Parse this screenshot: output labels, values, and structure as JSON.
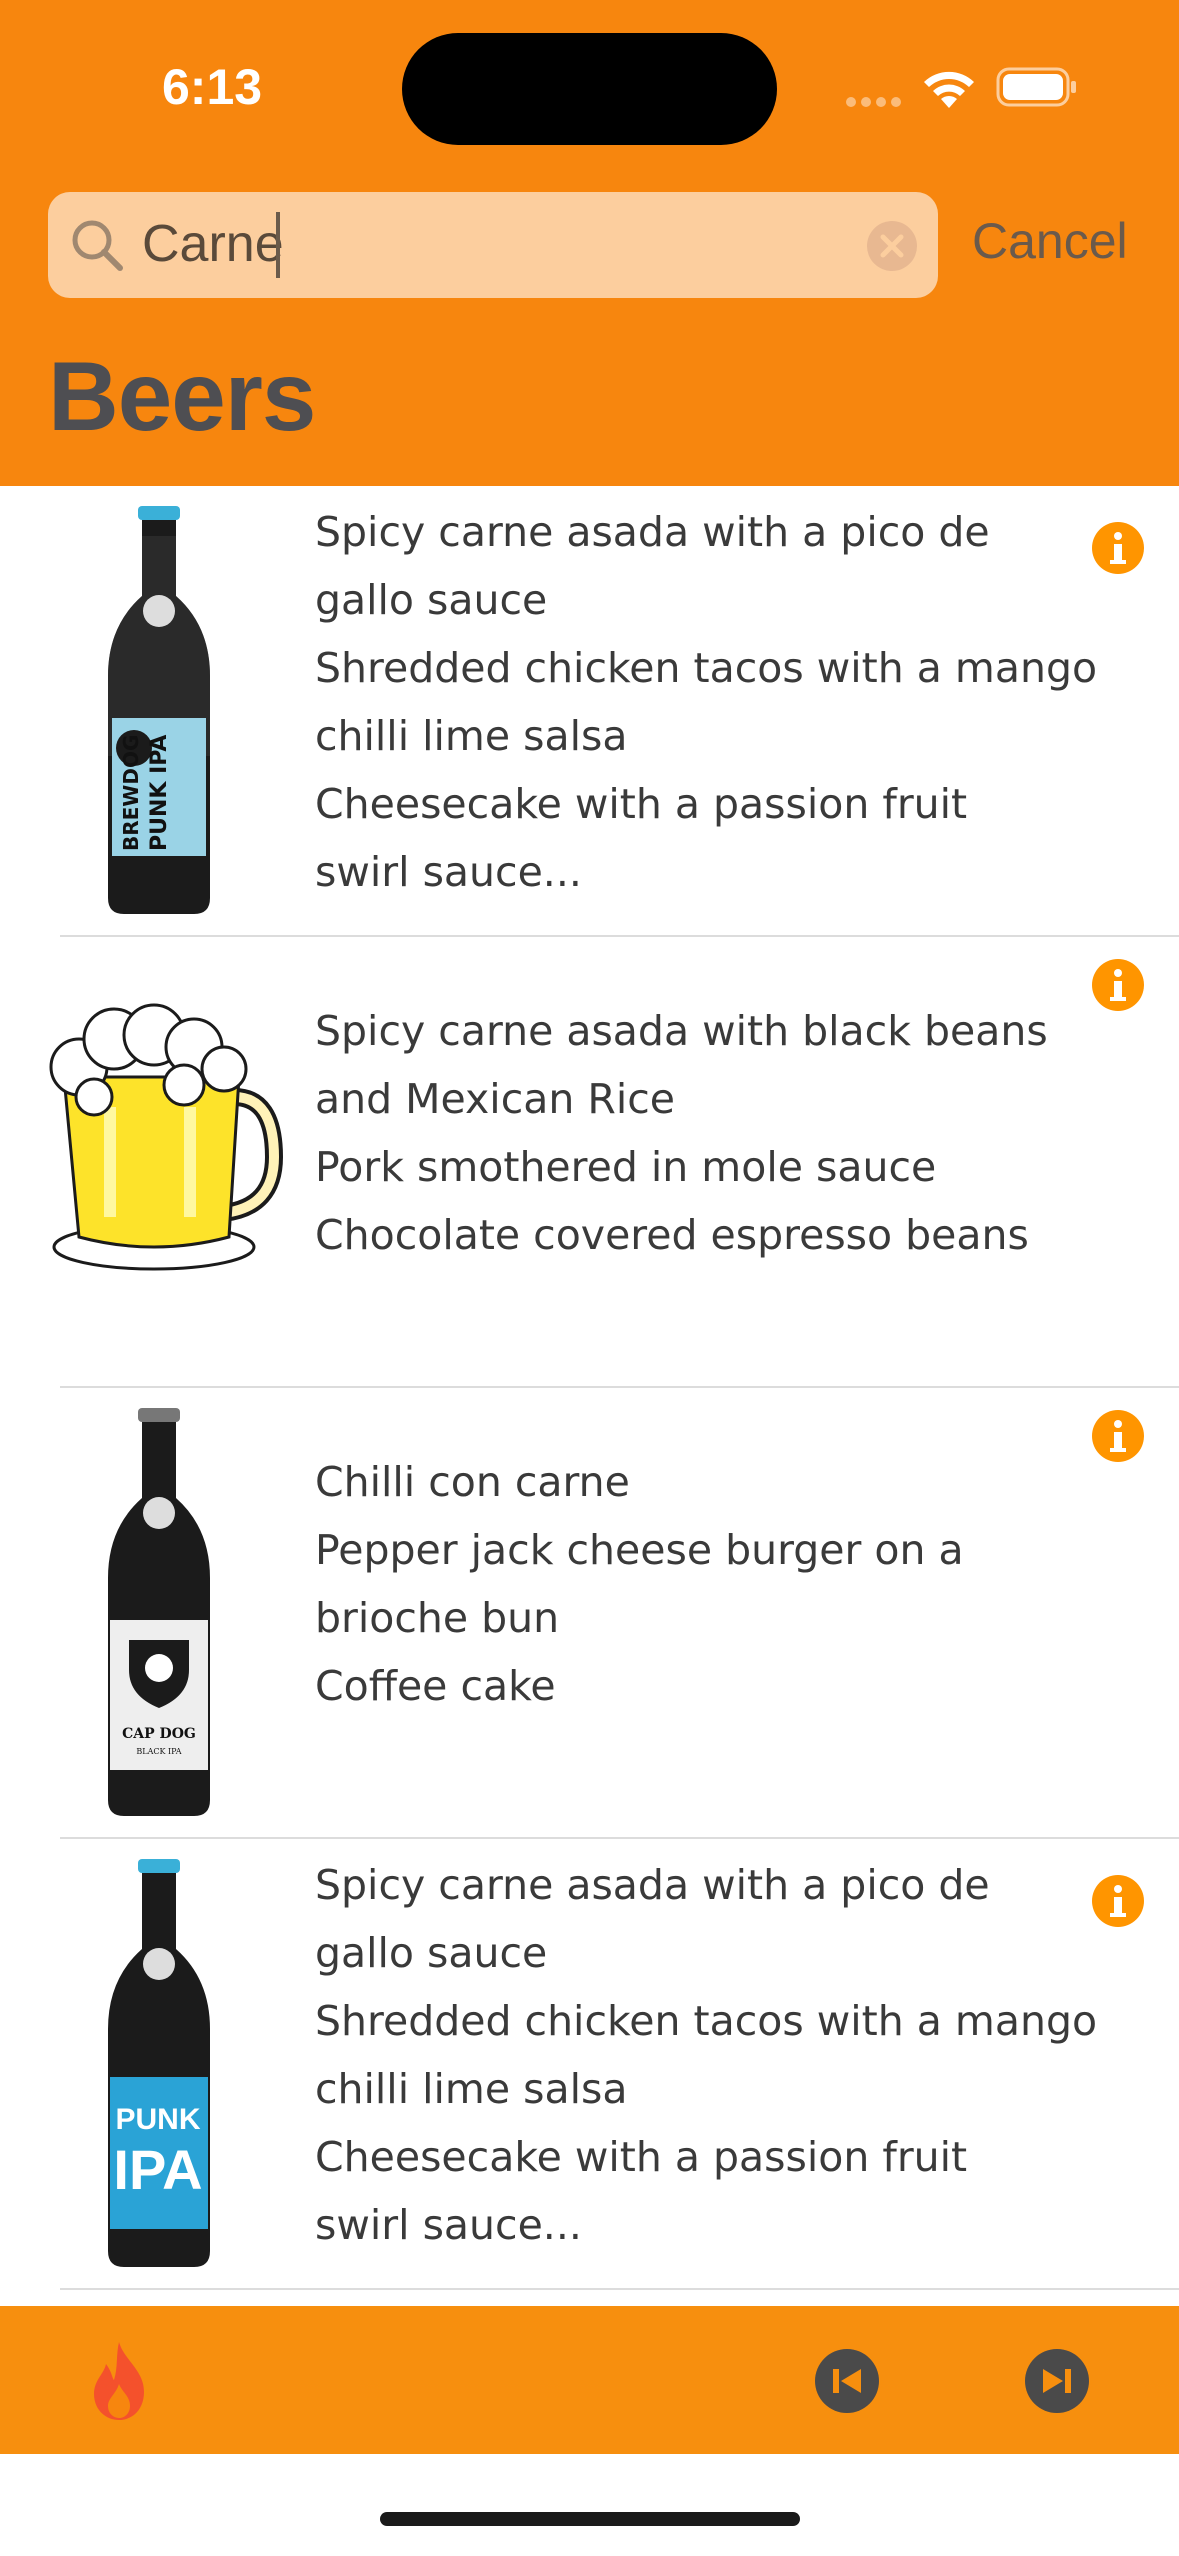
{
  "status_bar": {
    "time": "6:13"
  },
  "search": {
    "value": "Carne",
    "cancel_label": "Cancel"
  },
  "header": {
    "title": "Beers"
  },
  "colors": {
    "accent": "#F7860E",
    "toolbar": "#F78F0E",
    "info": "#FF9500",
    "search_bg": "#FCCE9E"
  },
  "results": [
    {
      "image": "punk-ipa-bottle",
      "food_pairing": "Spicy carne asada with a pico de\ngallo sauce\nShredded chicken tacos with a mango\nchilli lime salsa\nCheesecake with a passion fruit\nswirl sauce..."
    },
    {
      "image": "beer-mug",
      "food_pairing": "Spicy carne asada with black beans\nand Mexican Rice\nPork smothered in mole sauce\nChocolate covered espresso beans"
    },
    {
      "image": "cap-dog-bottle",
      "food_pairing": "Chilli con carne\nPepper jack cheese burger on a\nbrioche bun\nCoffee cake"
    },
    {
      "image": "punk-ipa-blue-bottle",
      "food_pairing": "Spicy carne asada with a pico de\ngallo sauce\nShredded chicken tacos with a mango\nchilli lime salsa\nCheesecake with a passion fruit\nswirl sauce..."
    }
  ],
  "toolbar": {
    "left_icon": "flame-icon",
    "prev_icon": "previous-page-icon",
    "next_icon": "next-page-icon"
  },
  "bottle_labels": {
    "brand": "BREWDOG",
    "punk_ipa": "PUNK IPA",
    "cap_dog": "CAP DOG",
    "cap_dog_sub": "BLACK IPA",
    "punk": "PUNK",
    "ipa": "IPA"
  }
}
